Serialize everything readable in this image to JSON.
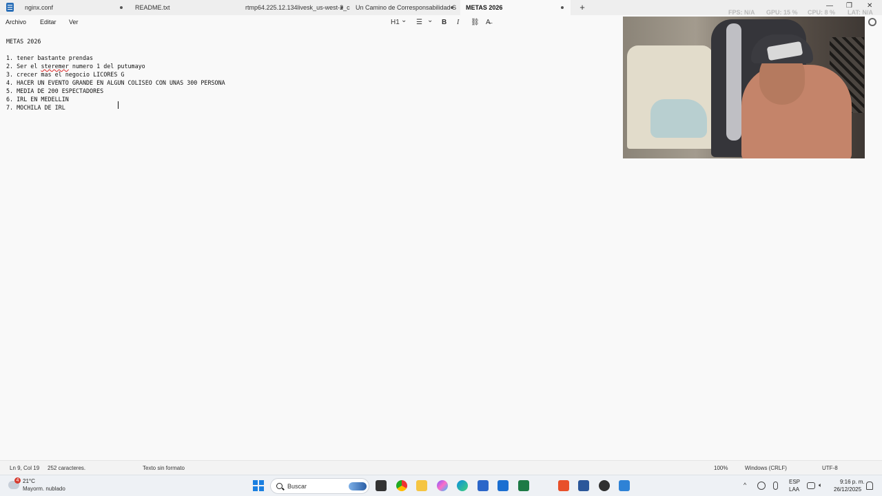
{
  "tabs": [
    {
      "label": "nginx.conf"
    },
    {
      "label": "README.txt"
    },
    {
      "label": "rtmp64.225.12.134livesk_us-west-2_c"
    },
    {
      "label": "Un Camino de Corresponsabilidad S"
    },
    {
      "label": "METAS 2026"
    }
  ],
  "new_tab_label": "+",
  "window_controls": {
    "minimize": "—",
    "maximize": "❐",
    "close": "✕"
  },
  "menu": {
    "file": "Archivo",
    "edit": "Editar",
    "view": "Ver"
  },
  "toolbar": {
    "heading": "H1",
    "heading_chevron": "⌄",
    "list": "☰",
    "list_chevron": "⌄",
    "bold": "B",
    "italic": "I",
    "link": "⛓",
    "format_clear": "A̶"
  },
  "document": {
    "title_line": "METAS 2026",
    "lines": [
      {
        "num": "1.",
        "text": "tener bastante prendas"
      },
      {
        "num": "2.",
        "pre": "Ser el ",
        "misspelled": "steremer",
        "post": " numero 1 del putumayo"
      },
      {
        "num": "3.",
        "text": "crecer mas el negocio LICORES G"
      },
      {
        "num": "4.",
        "text": "HACER UN EVENTO GRANDE EN ALGUN COLISEO CON UNAS 300 PERSONA"
      },
      {
        "num": "5.",
        "text": "MEDIA DE 200 ESPECTADORES"
      },
      {
        "num": "6.",
        "text": "IRL EN MEDELLIN"
      },
      {
        "num": "7.",
        "text": "MOCHILA DE IRL"
      }
    ]
  },
  "overlay_stats": {
    "fps": "FPS: N/A",
    "gpu": "GPU: 15 %",
    "cpu": "CPU: 8 %",
    "lat": "LAT: N/A"
  },
  "status": {
    "position": "Ln 9, Col 19",
    "chars": "252 caracteres.",
    "format": "Texto sin formato",
    "zoom": "100%",
    "line_ending": "Windows (CRLF)",
    "encoding": "UTF-8"
  },
  "taskbar": {
    "weather_badge": "4",
    "weather_temp": "21°C",
    "weather_desc": "Mayorm. nublado",
    "search_placeholder": "Buscar",
    "tray_chevron": "^",
    "lang_top": "ESP",
    "lang_bottom": "LAA",
    "time": "9:16 p. m.",
    "date": "26/12/2025"
  },
  "colors": {
    "accent": "#1a7fe0",
    "background": "#f9f9f9",
    "spell_error": "#d22222"
  }
}
